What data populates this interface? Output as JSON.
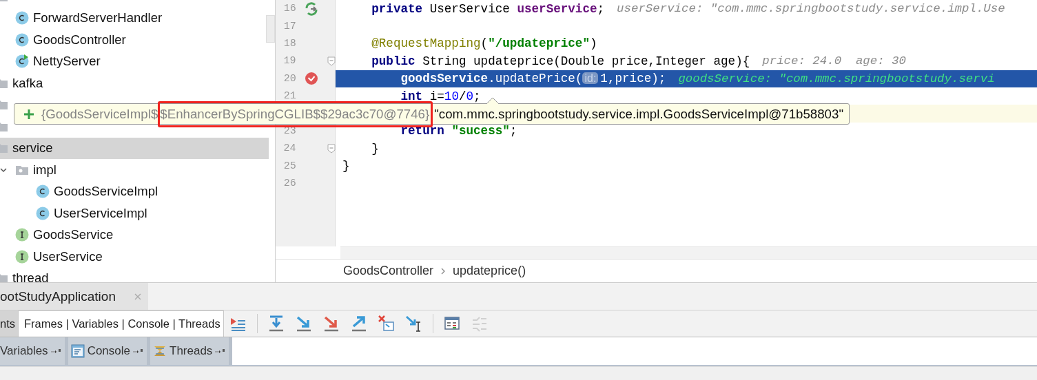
{
  "project_tree": [
    {
      "kind": "folder",
      "selected": false,
      "children": [
        {
          "label": "ForwardServerHandler",
          "kind": "class",
          "selected": false
        },
        {
          "label": "GoodsController",
          "kind": "class",
          "selected": false
        },
        {
          "label": "NettyServer",
          "kind": "runnable",
          "selected": false
        }
      ]
    },
    {
      "label": "kafka",
      "kind": "folder",
      "selected": false
    },
    {
      "kind": "folder",
      "selected": false
    },
    {
      "kind": "folder",
      "selected": false
    },
    {
      "label": "service",
      "kind": "folder",
      "selected": true,
      "children": [
        {
          "label": "impl",
          "kind": "package",
          "expanded": true,
          "selected": false,
          "children": [
            {
              "label": "GoodsServiceImpl",
              "kind": "class",
              "selected": false
            },
            {
              "label": "UserServiceImpl",
              "kind": "class",
              "selected": false
            }
          ]
        },
        {
          "label": "GoodsService",
          "kind": "interface",
          "selected": false
        },
        {
          "label": "UserService",
          "kind": "interface",
          "selected": false
        }
      ]
    },
    {
      "label": "thread",
      "kind": "folder",
      "selected": false
    }
  ],
  "code_lines": [
    {
      "number": "16",
      "kind": "override",
      "selected": false,
      "caret": false,
      "tokens": [
        {
          "kind": "keyword",
          "text": "    private"
        },
        {
          "kind": "plain",
          "text": " UserService "
        },
        {
          "kind": "field",
          "text": "userService"
        },
        {
          "kind": "plain",
          "text": ";"
        }
      ],
      "hint": "userService: \"com.mmc.springbootstudy.service.impl.Use"
    },
    {
      "number": "17",
      "kind": "plain",
      "selected": false,
      "caret": false
    },
    {
      "number": "18",
      "kind": "plain",
      "selected": false,
      "caret": false,
      "tokens": [
        {
          "kind": "annotation",
          "text": "    @RequestMapping"
        },
        {
          "kind": "plain",
          "text": "("
        },
        {
          "kind": "string",
          "text": "\"/updateprice\""
        },
        {
          "kind": "plain",
          "text": ")"
        }
      ]
    },
    {
      "number": "19",
      "kind": "fold",
      "selected": false,
      "caret": false,
      "tokens": [
        {
          "kind": "keyword",
          "text": "    public"
        },
        {
          "kind": "plain",
          "text": " String updateprice(Double price,Integer age){"
        }
      ],
      "hint": "price: 24.0  age: 30"
    },
    {
      "number": "20",
      "kind": "breakpoint",
      "selected": true,
      "caret": false,
      "tokens": [
        {
          "kind": "field",
          "text": "        goodsService"
        },
        {
          "kind": "plain",
          "text": ".updatePrice("
        },
        {
          "kind": "inlay",
          "text": "id:"
        },
        {
          "kind": "plain",
          "text": "1,price);"
        }
      ],
      "hint": "goodsService: \"com.mmc.springbootstudy.servi"
    },
    {
      "number": "21",
      "kind": "plain",
      "selected": false,
      "caret": false,
      "tokens": [
        {
          "kind": "keyword",
          "text": "        int"
        },
        {
          "kind": "plain",
          "text": " i="
        },
        {
          "kind": "number",
          "text": "10"
        },
        {
          "kind": "plain",
          "text": "/"
        },
        {
          "kind": "number",
          "text": "0"
        },
        {
          "kind": "plain",
          "text": ";"
        }
      ]
    },
    {
      "kind": "plain",
      "selected": false,
      "caret": true
    },
    {
      "number": "23",
      "kind": "plain",
      "selected": false,
      "caret": false,
      "tokens": [
        {
          "kind": "keyword",
          "text": "        return "
        },
        {
          "kind": "string",
          "text": "\"sucess\""
        },
        {
          "kind": "plain",
          "text": ";"
        }
      ]
    },
    {
      "number": "24",
      "kind": "fold",
      "selected": false,
      "caret": false,
      "tokens": [
        {
          "kind": "plain",
          "text": "    }"
        }
      ]
    },
    {
      "number": "25",
      "kind": "plain",
      "selected": false,
      "caret": false,
      "tokens": [
        {
          "kind": "plain",
          "text": "}"
        }
      ]
    },
    {
      "number": "26",
      "kind": "plain",
      "selected": false,
      "caret": false
    }
  ],
  "breadcrumb": [
    "GoodsController",
    "updateprice()"
  ],
  "tooltip": {
    "type_text": "{GoodsServiceImpl$",
    "highlighted_text": "$EnhancerBySpringCGLIB$$29ac3c70@7746}",
    "value_text": "\"com.mmc.springbootstudy.service.impl.GoodsServiceImpl@71b58803\""
  },
  "session_tab": {
    "label": "ootStudyApplication"
  },
  "debugger_tabs": [
    {
      "label": "nts",
      "selected": false
    },
    {
      "label": "Frames | Variables | Console | Threads",
      "selected": true
    }
  ],
  "toolbar": [
    {
      "kind": "execution",
      "disabled": false
    },
    {
      "kind": "separator"
    },
    {
      "kind": "stepover",
      "disabled": false
    },
    {
      "kind": "stepinto",
      "disabled": false
    },
    {
      "kind": "forcestepinto",
      "disabled": false
    },
    {
      "kind": "stepout",
      "disabled": false
    },
    {
      "kind": "dropframe",
      "disabled": false
    },
    {
      "kind": "runtocursor",
      "disabled": false
    },
    {
      "kind": "separator"
    },
    {
      "kind": "evaluate",
      "disabled": false
    },
    {
      "kind": "trace",
      "disabled": true
    }
  ],
  "panel_tabs": [
    {
      "label": "Variables",
      "kind": "variables",
      "selected": false
    },
    {
      "label": "Console",
      "kind": "console",
      "selected": false
    },
    {
      "label": "Threads",
      "kind": "threads",
      "selected": false
    }
  ]
}
